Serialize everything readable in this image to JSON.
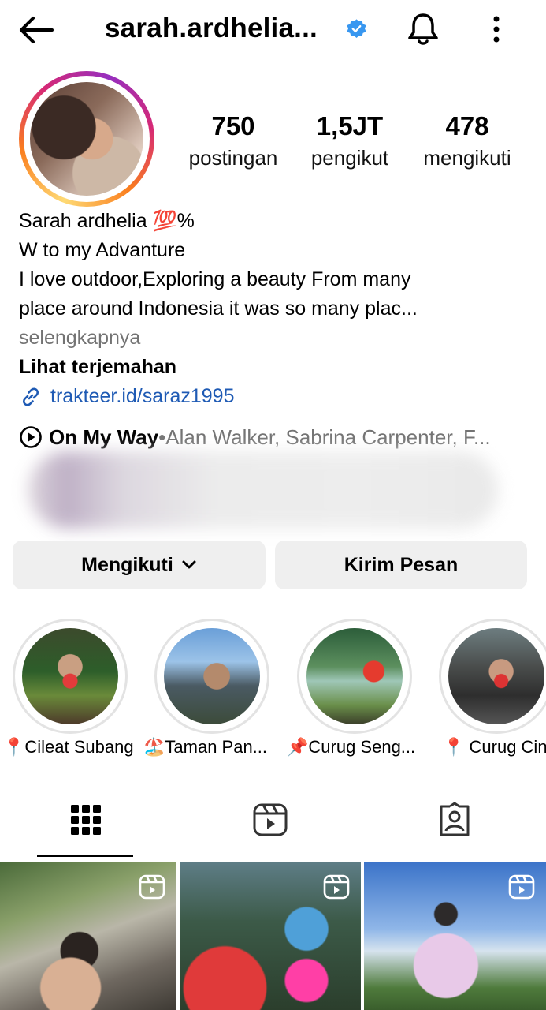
{
  "header": {
    "username": "sarah.ardhelia...",
    "verified_color": "#3897f0"
  },
  "stats": [
    {
      "value": "750",
      "label": "postingan"
    },
    {
      "value": "1,5JT",
      "label": "pengikut"
    },
    {
      "value": "478",
      "label": "mengikuti"
    }
  ],
  "bio": {
    "name": "Sarah ardhelia 💯%",
    "line1": "W to my Advanture",
    "line2": "I love outdoor,Exploring a beauty From many",
    "line3": "place around Indonesia it was so many plac...",
    "more": "selengkapnya",
    "translate": "Lihat terjemahan",
    "link": "trakteer.id/saraz1995"
  },
  "music": {
    "title": "On My Way",
    "separator": " • ",
    "artists": "Alan Walker, Sabrina Carpenter, F..."
  },
  "buttons": {
    "follow": "Mengikuti",
    "message": "Kirim Pesan"
  },
  "highlights": [
    {
      "label": "📍Cileat Subang"
    },
    {
      "label": "🏖️Taman Pan..."
    },
    {
      "label": "📌Curug Seng..."
    },
    {
      "label": "📍 Curug Cina"
    }
  ],
  "tabs": [
    "grid-icon",
    "reels-icon",
    "tagged-icon"
  ],
  "colors": {
    "link": "#1e5ab4",
    "muted": "#737373",
    "button_bg": "#efefef"
  }
}
